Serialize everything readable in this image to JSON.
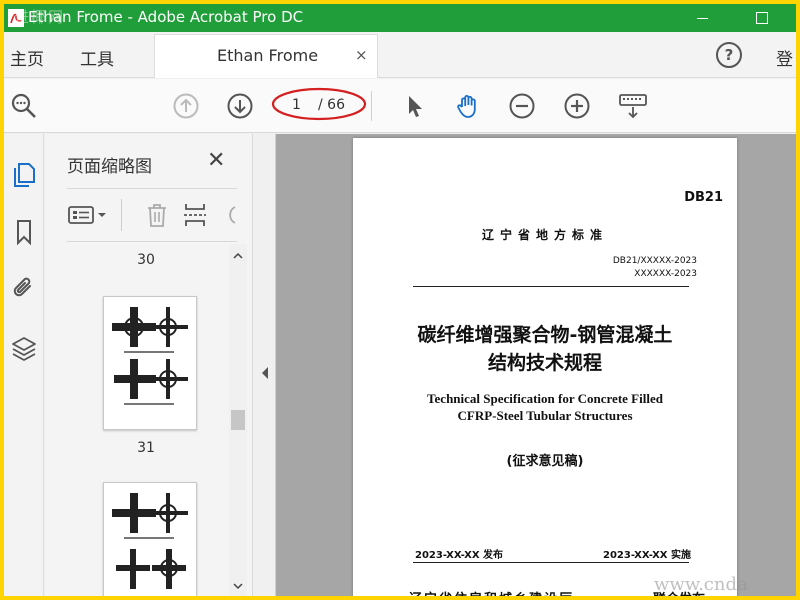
{
  "window": {
    "title": "Ethan Frome - Adobe Acrobat Pro DC",
    "watermark": "进椰网"
  },
  "menubar": {
    "home": "主页",
    "tools": "工具",
    "tab_title": "Ethan Frome",
    "tab_close": "×",
    "help": "?",
    "login": "登"
  },
  "toolbar": {
    "current_page": "1",
    "total_pages": "/ 66",
    "ring_color": "#d42020"
  },
  "thumbnail_panel": {
    "title": "页面缩略图",
    "close": "✕",
    "page_labels": [
      "30",
      "31"
    ]
  },
  "document": {
    "standard_code": "DB21",
    "province_standard": "辽宁省地方标准",
    "code_line1": "DB21/XXXXX-2023",
    "code_line2": "XXXXXX-2023",
    "title_cn_line1": "碳纤维增强聚合物-钢管混凝土",
    "title_cn_line2": "结构技术规程",
    "title_en_line1": "Technical Specification for Concrete Filled",
    "title_en_line2": "CFRP-Steel Tubular Structures",
    "draft_label": "(征求意见稿)",
    "publish_date": "2023-XX-XX 发布",
    "implement_date": "2023-XX-XX 实施",
    "issuer": "辽宁省住房和城乡建设厅",
    "joint_issue": "联合发布"
  },
  "watermark_bottom": "www.cnda",
  "colors": {
    "titlebar": "#1f9e3a",
    "frame": "#FFD400",
    "accent_blue": "#1a6fc9"
  }
}
